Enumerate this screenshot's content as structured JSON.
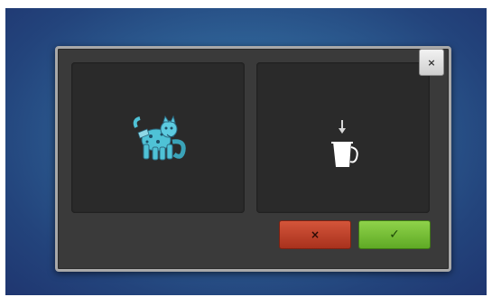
{
  "dialog": {
    "close_label": "×",
    "cancel_label": "×",
    "confirm_label": "✓"
  },
  "icons": {
    "close": "close-icon",
    "cancel": "cancel-icon",
    "confirm": "checkmark-icon",
    "embroidery_preview": "embroidery-design-preview",
    "thread_source": "arrow-down-icon",
    "pitcher": "pitcher-icon"
  },
  "colors": {
    "cancel": "#b8402a",
    "confirm": "#76bf34",
    "design": "#4fc2d6"
  }
}
